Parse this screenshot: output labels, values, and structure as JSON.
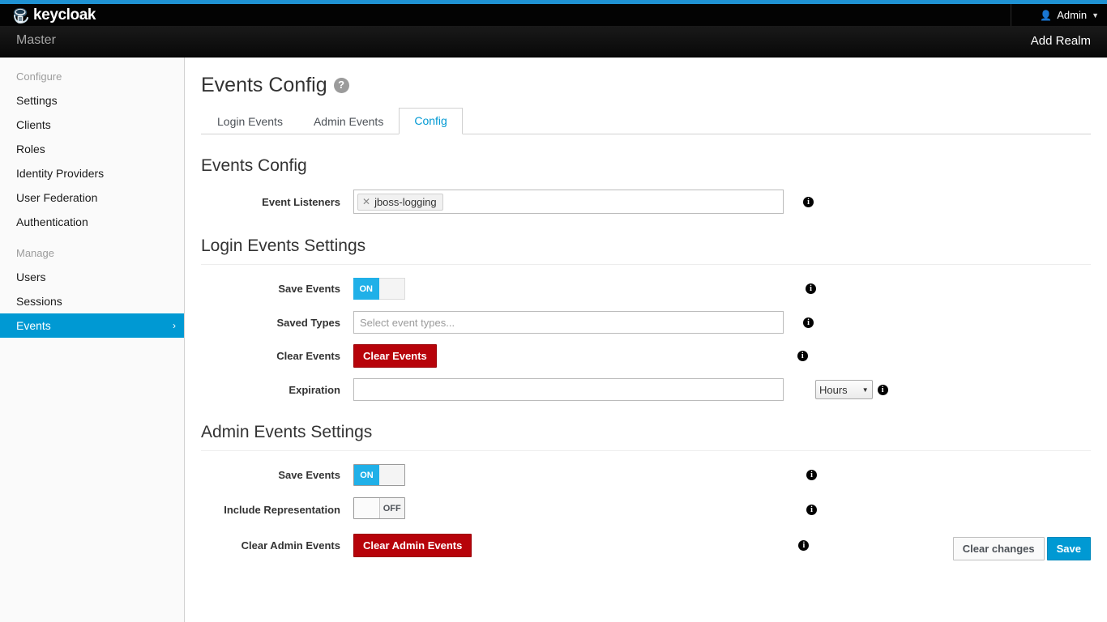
{
  "branding": {
    "logo_text": "keycloak",
    "logo_icon": "keycloak-logo-icon"
  },
  "header": {
    "user_icon": "user-icon",
    "user_label": "Admin",
    "caret_icon": "chevron-down-icon"
  },
  "realm_bar": {
    "realm_name": "Master",
    "add_realm_label": "Add Realm"
  },
  "sidebar": {
    "groups": [
      {
        "title": "Configure",
        "items": [
          {
            "label": "Settings",
            "active": false
          },
          {
            "label": "Clients",
            "active": false
          },
          {
            "label": "Roles",
            "active": false
          },
          {
            "label": "Identity Providers",
            "active": false
          },
          {
            "label": "User Federation",
            "active": false
          },
          {
            "label": "Authentication",
            "active": false
          }
        ]
      },
      {
        "title": "Manage",
        "items": [
          {
            "label": "Users",
            "active": false
          },
          {
            "label": "Sessions",
            "active": false
          },
          {
            "label": "Events",
            "active": true,
            "chevron": "chevron-right-icon"
          }
        ]
      }
    ]
  },
  "page": {
    "title": "Events Config",
    "help_icon": "question-mark-icon",
    "tabs": [
      {
        "label": "Login Events",
        "active": false
      },
      {
        "label": "Admin Events",
        "active": false
      },
      {
        "label": "Config",
        "active": true
      }
    ]
  },
  "events_config": {
    "heading": "Events Config",
    "event_listeners": {
      "label": "Event Listeners",
      "chips": [
        {
          "value": "jboss-logging",
          "remove_icon": "close-icon"
        }
      ],
      "info_icon": "info-icon"
    }
  },
  "login_events_settings": {
    "heading": "Login Events Settings",
    "save_events": {
      "label": "Save Events",
      "state": "ON",
      "on_label": "ON",
      "off_label": "",
      "info_icon": "info-icon"
    },
    "saved_types": {
      "label": "Saved Types",
      "value": "",
      "placeholder": "Select event types...",
      "info_icon": "info-icon"
    },
    "clear_events": {
      "label": "Clear Events",
      "button_label": "Clear Events",
      "info_icon": "info-icon"
    },
    "expiration": {
      "label": "Expiration",
      "value": "",
      "placeholder": "",
      "unit_selected": "Hours",
      "unit_caret": "chevron-down-icon",
      "info_icon": "info-icon"
    }
  },
  "admin_events_settings": {
    "heading": "Admin Events Settings",
    "save_events": {
      "label": "Save Events",
      "state": "ON",
      "on_label": "ON",
      "info_icon": "info-icon"
    },
    "include_representation": {
      "label": "Include Representation",
      "state": "OFF",
      "off_label": "OFF",
      "info_icon": "info-icon"
    },
    "clear_admin_events": {
      "label": "Clear Admin Events",
      "button_label": "Clear Admin Events",
      "info_icon": "info-icon"
    }
  },
  "actions": {
    "clear_changes_label": "Clear changes",
    "save_label": "Save"
  },
  "colors": {
    "accent_blue": "#1f92d3",
    "active_nav_blue": "#0099d3",
    "toggle_on_blue": "#20b0e8",
    "danger_red": "#b7030a",
    "header_black": "#030303"
  }
}
